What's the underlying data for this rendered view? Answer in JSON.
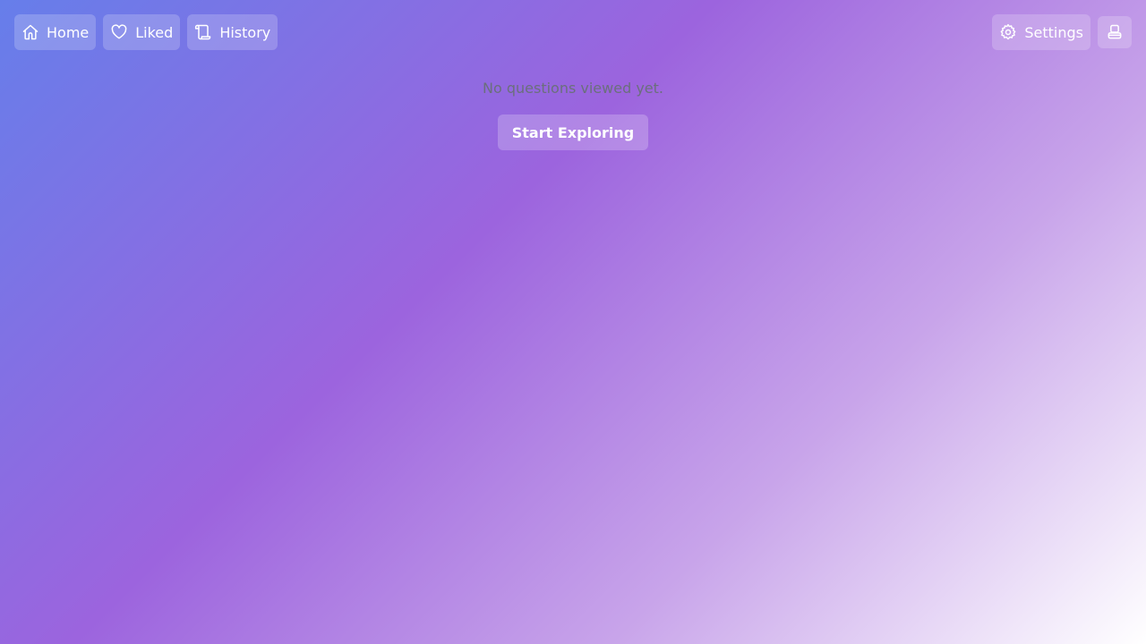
{
  "nav": {
    "home": {
      "label": "Home",
      "icon": "home-icon"
    },
    "liked": {
      "label": "Liked",
      "icon": "heart-icon"
    },
    "history": {
      "label": "History",
      "icon": "scroll-icon"
    },
    "settings": {
      "label": "Settings",
      "icon": "gear-icon"
    },
    "profile": {
      "icon": "user-icon"
    }
  },
  "main": {
    "empty_message": "No questions viewed yet.",
    "cta_label": "Start Exploring"
  },
  "colors": {
    "gradient_start": "#667eea",
    "gradient_mid": "#9c64de",
    "gradient_end": "#ffffff",
    "muted_text": "#6b6f7c"
  }
}
